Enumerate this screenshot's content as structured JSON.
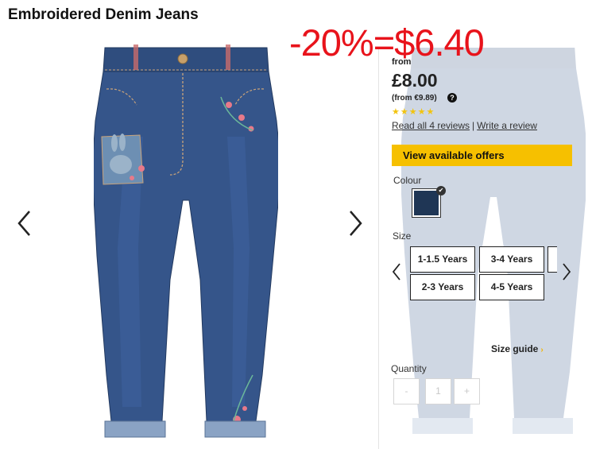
{
  "product": {
    "title": "Embroidered Denim Jeans",
    "promo_overlay": "-20%=$6.40"
  },
  "pricing": {
    "from_label": "from",
    "price": "£8.00",
    "secondary_price": "(from €9.89)",
    "help_icon": "?",
    "rating_stars": 5,
    "stars_text": "★★★★★"
  },
  "reviews": {
    "read_link": "Read all 4 reviews",
    "separator": "|",
    "write_link": "Write a review"
  },
  "offers": {
    "button_label": "View available offers",
    "accent_color": "#f6c000"
  },
  "colour": {
    "label": "Colour",
    "selected_swatch_color": "#1f3655"
  },
  "size": {
    "label": "Size",
    "options": [
      "1-1.5 Years",
      "3-4 Years",
      "2-3 Years",
      "4-5 Years"
    ]
  },
  "size_guide": {
    "label": "Size guide",
    "chevron": "›"
  },
  "quantity": {
    "label": "Quantity",
    "minus": "-",
    "value": "1",
    "plus": "+"
  },
  "gallery": {
    "prev_icon": "chevron-left-icon",
    "next_icon": "chevron-right-icon"
  },
  "colors": {
    "promo_red": "#e8131b",
    "denim": "#2f4d7e"
  }
}
